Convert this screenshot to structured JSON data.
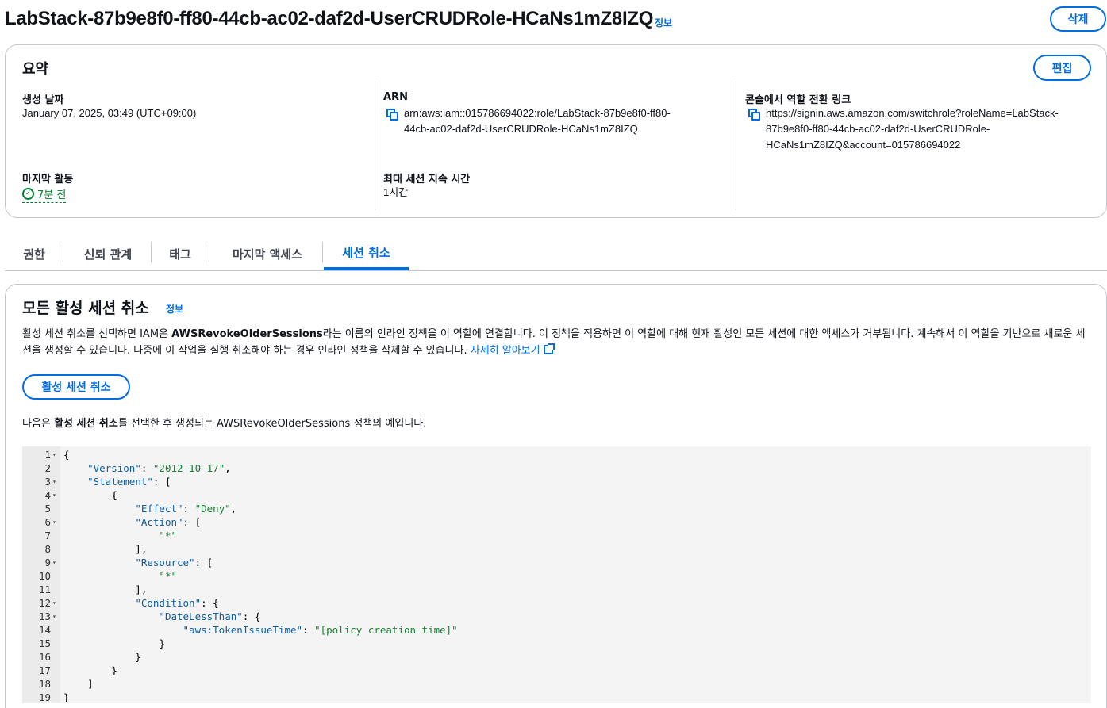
{
  "header": {
    "title": "LabStack-87b9e8f0-ff80-44cb-ac02-daf2d-UserCRUDRole-HCaNs1mZ8IZQ",
    "info_label": "정보",
    "delete_label": "삭제"
  },
  "summary": {
    "title": "요약",
    "edit_label": "편집",
    "created_label": "생성 날짜",
    "created_value": "January 07, 2025, 03:49 (UTC+09:00)",
    "last_activity_label": "마지막 활동",
    "last_activity_value": "7분 전",
    "arn_label": "ARN",
    "arn_line1": "arn:aws:iam::015786694022:role/LabStack-87b9e8f0-ff80-",
    "arn_line2": "44cb-ac02-daf2d-UserCRUDRole-HCaNs1mZ8IZQ",
    "max_session_label": "최대 세션 지속 시간",
    "max_session_value": "1시간",
    "switch_link_label": "콘솔에서 역할 전환 링크",
    "switch_link_line1": "https://signin.aws.amazon.com/switchrole?roleName=LabStack-",
    "switch_link_line2": "87b9e8f0-ff80-44cb-ac02-daf2d-UserCRUDRole-",
    "switch_link_line3": "HCaNs1mZ8IZQ&account=015786694022"
  },
  "tabs": [
    {
      "label": "권한"
    },
    {
      "label": "신뢰 관계"
    },
    {
      "label": "태그"
    },
    {
      "label": "마지막 액세스"
    },
    {
      "label": "세션 취소"
    }
  ],
  "revoke": {
    "title": "모든 활성 세션 취소",
    "info_label": "정보",
    "desc_part1": "활성 세션 취소를 선택하면 IAM은 ",
    "desc_bold": "AWSRevokeOlderSessions",
    "desc_part2": "라는 이름의 인라인 정책을 이 역할에 연결합니다. 이 정책을 적용하면 이 역할에 대해 현재 활성인 모든 세션에 대한 액세스가 거부됩니다. 계속해서 이 역할을 기반으로 새로운 세션을 생성할 수 있습니다. 나중에 이 작업을 실행 취소해야 하는 경우 인라인 정책을 삭제할 수 있습니다. ",
    "learn_more": "자세히 알아보기",
    "button_label": "활성 세션 취소",
    "note_part1": "다음은 ",
    "note_bold": "활성 세션 취소",
    "note_part2": "를 선택한 후 생성되는 AWSRevokeOlderSessions 정책의 예입니다."
  },
  "code": {
    "lines": [
      {
        "n": "1",
        "fold": true,
        "html": "{"
      },
      {
        "n": "2",
        "fold": false,
        "html": "    <span class=\"k\">\"Version\"</span>: <span class=\"s\">\"2012-10-17\"</span>,"
      },
      {
        "n": "3",
        "fold": true,
        "html": "    <span class=\"k\">\"Statement\"</span>: ["
      },
      {
        "n": "4",
        "fold": true,
        "html": "        {"
      },
      {
        "n": "5",
        "fold": false,
        "html": "            <span class=\"k\">\"Effect\"</span>: <span class=\"s\">\"Deny\"</span>,"
      },
      {
        "n": "6",
        "fold": true,
        "html": "            <span class=\"k\">\"Action\"</span>: ["
      },
      {
        "n": "7",
        "fold": false,
        "html": "                <span class=\"s\">\"*\"</span>"
      },
      {
        "n": "8",
        "fold": false,
        "html": "            ],"
      },
      {
        "n": "9",
        "fold": true,
        "html": "            <span class=\"k\">\"Resource\"</span>: ["
      },
      {
        "n": "10",
        "fold": false,
        "html": "                <span class=\"s\">\"*\"</span>"
      },
      {
        "n": "11",
        "fold": false,
        "html": "            ],"
      },
      {
        "n": "12",
        "fold": true,
        "html": "            <span class=\"k\">\"Condition\"</span>: {"
      },
      {
        "n": "13",
        "fold": true,
        "html": "                <span class=\"k\">\"DateLessThan\"</span>: {"
      },
      {
        "n": "14",
        "fold": false,
        "html": "                    <span class=\"k\">\"aws:TokenIssueTime\"</span>: <span class=\"s\">\"[policy creation time]\"</span>"
      },
      {
        "n": "15",
        "fold": false,
        "html": "                }"
      },
      {
        "n": "16",
        "fold": false,
        "html": "            }"
      },
      {
        "n": "17",
        "fold": false,
        "html": "        }"
      },
      {
        "n": "18",
        "fold": false,
        "html": "    ]"
      },
      {
        "n": "19",
        "fold": false,
        "html": "}"
      }
    ]
  },
  "colors": {
    "accent": "#006ce0",
    "success": "#00802f",
    "border": "#c6c6cd"
  }
}
